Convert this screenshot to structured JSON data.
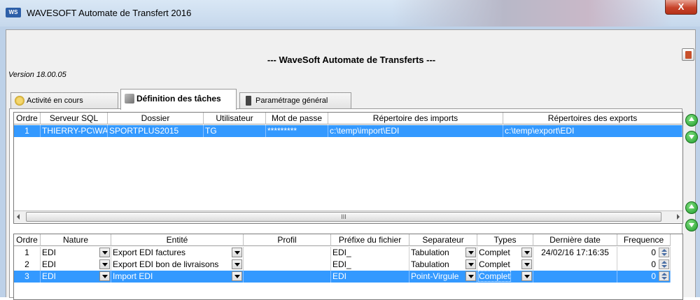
{
  "window": {
    "title": "WAVESOFT Automate de Transfert 2016",
    "close_label": "X",
    "app_icon_text": "WS"
  },
  "header": {
    "title": "--- WaveSoft Automate de Transferts ---",
    "version": "Version 18.00.05"
  },
  "tabs": [
    {
      "label": "Activité en cours",
      "icon": "activity-icon",
      "active": false
    },
    {
      "label": "Définition des tâches",
      "icon": "tasks-icon",
      "active": true
    },
    {
      "label": "Paramétrage général",
      "icon": "settings-icon",
      "active": false
    }
  ],
  "servers": {
    "columns": [
      "Ordre",
      "Serveur SQL",
      "Dossier",
      "Utilisateur",
      "Mot de passe",
      "Répertoire des imports",
      "Répertoires des exports"
    ],
    "rows": [
      {
        "ordre": "1",
        "serveur": "THIERRY-PC\\WAVE",
        "dossier": "SPORTPLUS2015",
        "utilisateur": "TG",
        "mot_de_passe": "*********",
        "imports": "c:\\temp\\import\\EDI",
        "exports": "c:\\temp\\export\\EDI",
        "selected": true
      }
    ],
    "scroll_label": "III"
  },
  "tasks": {
    "columns": [
      "Ordre",
      "Nature",
      "Entité",
      "Profil",
      "Préfixe du fichier",
      "Separateur",
      "Types",
      "Dernière date",
      "Frequence"
    ],
    "rows": [
      {
        "ordre": "1",
        "nature": "EDI",
        "entite": "Export EDI factures",
        "profil": "",
        "prefixe": "EDI_",
        "separateur": "Tabulation",
        "types": "Complet",
        "derniere_date": "24/02/16 17:16:35",
        "frequence": "0",
        "selected": false
      },
      {
        "ordre": "2",
        "nature": "EDI",
        "entite": "Export EDI bon de livraisons",
        "profil": "",
        "prefixe": "EDI_",
        "separateur": "Tabulation",
        "types": "Complet",
        "derniere_date": "",
        "frequence": "0",
        "selected": false
      },
      {
        "ordre": "3",
        "nature": "EDI",
        "entite": "Import EDI",
        "profil": "",
        "prefixe": "EDI",
        "separateur": "Point-Virgule",
        "types": "Complet",
        "derniere_date": "",
        "frequence": "0",
        "selected": true
      }
    ]
  },
  "colors": {
    "selection": "#3399ff",
    "titlebar": "#c6d8ec",
    "move_buttons": "#1e9a2a"
  }
}
